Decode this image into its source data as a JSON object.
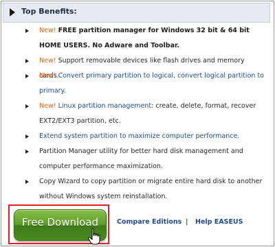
{
  "header": {
    "title": "Top Benefits:"
  },
  "benefits": [
    {
      "parts": [
        {
          "text": "New! ",
          "style": "new"
        },
        {
          "text": "FREE partition manager for Windows 32 bit & 64 bit HOME USERS. No Adware and Toolbar.",
          "style": "bold"
        }
      ]
    },
    {
      "parts": [
        {
          "text": "New! ",
          "style": "new"
        },
        {
          "text": "Support removable devices like flash drives and memory cards.",
          "style": "black"
        }
      ]
    },
    {
      "parts": [
        {
          "text": "New! ",
          "style": "new"
        },
        {
          "text": "Convert primary partition to logical, convert logical partition to primary.",
          "style": "blue"
        }
      ]
    },
    {
      "parts": [
        {
          "text": "New! ",
          "style": "new"
        },
        {
          "text": "Linux partition management",
          "style": "blue"
        },
        {
          "text": ": create, delete, format, recover EXT2/EXT3 partition, etc.",
          "style": "black"
        }
      ]
    },
    {
      "parts": [
        {
          "text": "Extend system partition to maximize computer performance.",
          "style": "blue"
        }
      ]
    },
    {
      "parts": [
        {
          "text": "Partition Manager utility for better hard disk management and computer performance maximization.",
          "style": "black"
        }
      ]
    },
    {
      "parts": [
        {
          "text": "Copy Wizard to copy partition or migrate entire hard disk to another without Windows system reinstallation.",
          "style": "black"
        }
      ]
    }
  ],
  "download": {
    "label": "Free Download"
  },
  "links": {
    "compare": "Compare Editions",
    "separator": "|",
    "help": "Help EASEUS"
  },
  "colors": {
    "new": "#e26518",
    "link": "#1f4a8f",
    "highlight_border": "#ea1c2a",
    "button_green": "#5f9e2a"
  }
}
